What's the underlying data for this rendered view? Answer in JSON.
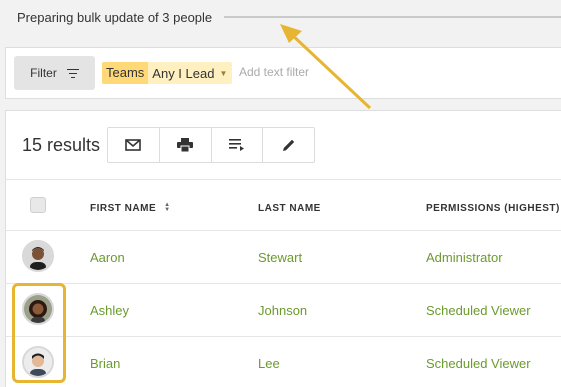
{
  "progress": {
    "message": "Preparing bulk update of 3 people"
  },
  "filter": {
    "button_label": "Filter",
    "chip_key": "Teams",
    "chip_value": "Any I Lead",
    "text_placeholder": "Add text filter"
  },
  "results": {
    "count_label": "15 results",
    "toolbar": [
      {
        "icon": "mail-icon"
      },
      {
        "icon": "print-icon"
      },
      {
        "icon": "sort-list-icon"
      },
      {
        "icon": "edit-icon"
      }
    ]
  },
  "table": {
    "headers": {
      "first": "FIRST NAME",
      "last": "LAST NAME",
      "permissions": "PERMISSIONS (HIGHEST)"
    },
    "rows": [
      {
        "first": "Aaron",
        "last": "Stewart",
        "permissions": "Administrator"
      },
      {
        "first": "Ashley",
        "last": "Johnson",
        "permissions": "Scheduled Viewer"
      },
      {
        "first": "Brian",
        "last": "Lee",
        "permissions": "Scheduled Viewer"
      }
    ]
  },
  "colors": {
    "link": "#6b9b2d",
    "highlight": "#e6b531",
    "chip_key": "#ffd978",
    "chip_value": "#fff0c2"
  }
}
